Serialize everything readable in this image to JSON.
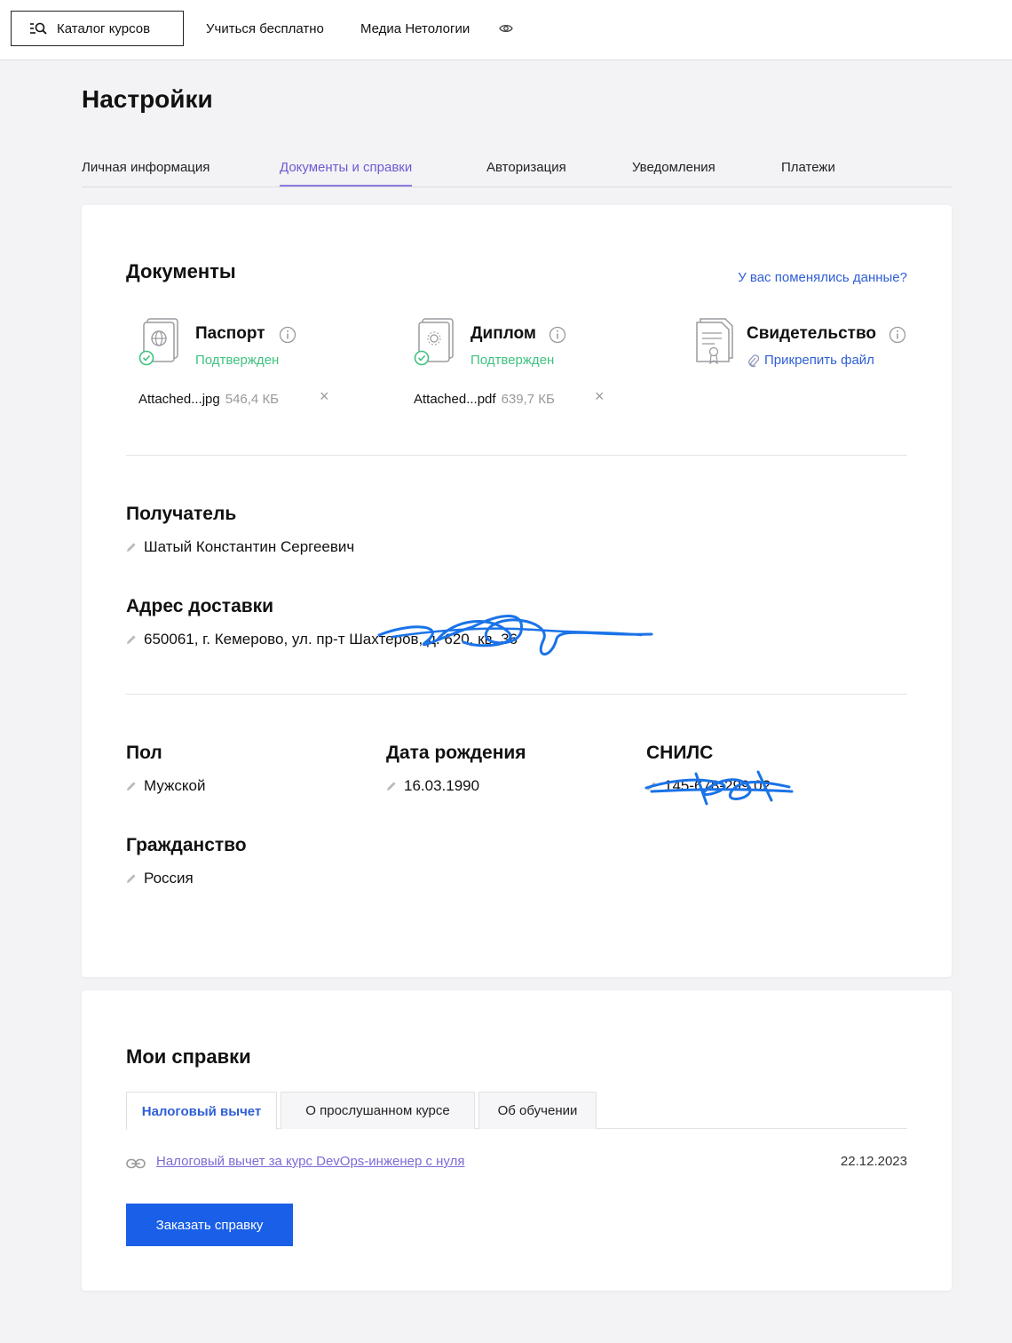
{
  "topbar": {
    "catalog_label": "Каталог курсов",
    "nav": [
      "Учиться бесплатно",
      "Медиа Нетологии"
    ]
  },
  "page": {
    "title": "Настройки",
    "tabs": [
      "Личная информация",
      "Документы и справки",
      "Авторизация",
      "Уведомления",
      "Платежи"
    ],
    "active_tab": "Документы и справки"
  },
  "documents": {
    "title": "Документы",
    "changed_link": "У вас поменялись данные?",
    "items": [
      {
        "title": "Паспорт",
        "status": "Подтвержден",
        "file_name": "Attached...jpg",
        "file_size": "546,4 КБ",
        "icon": "passport-icon"
      },
      {
        "title": "Диплом",
        "status": "Подтвержден",
        "file_name": "Attached...pdf",
        "file_size": "639,7 КБ",
        "icon": "diploma-icon"
      },
      {
        "title": "Свидетельство",
        "attach_label": "Прикрепить файл",
        "icon": "certificate-icon"
      }
    ],
    "status_color": "#3fc280"
  },
  "recipient": {
    "label": "Получатель",
    "value": "Шатый Константин Сергеевич"
  },
  "address": {
    "label": "Адрес доставки",
    "value": "650061, г. Кемерово, ул. пр-т Шахтеров, д. 620, кв. 36"
  },
  "personal": {
    "gender": {
      "label": "Пол",
      "value": "Мужской"
    },
    "birthdate": {
      "label": "Дата рождения",
      "value": "16.03.1990"
    },
    "snils": {
      "label": "СНИЛС",
      "value": "145-678-299 02"
    },
    "citizenship": {
      "label": "Гражданство",
      "value": "Россия"
    }
  },
  "references": {
    "title": "Мои справки",
    "tabs": [
      "Налоговый вычет",
      "О прослушанном курсе",
      "Об обучении"
    ],
    "active_tab": "Налоговый вычет",
    "items": [
      {
        "link": "Налоговый вычет за курс DevOps-инженер с нуля",
        "date": "22.12.2023"
      }
    ],
    "order_button": "Заказать справку"
  },
  "colors": {
    "accent": "#1a5fe8",
    "tab_active": "#6e5ad2",
    "link": "#2f5fd6",
    "scribble": "#1a73e8"
  }
}
